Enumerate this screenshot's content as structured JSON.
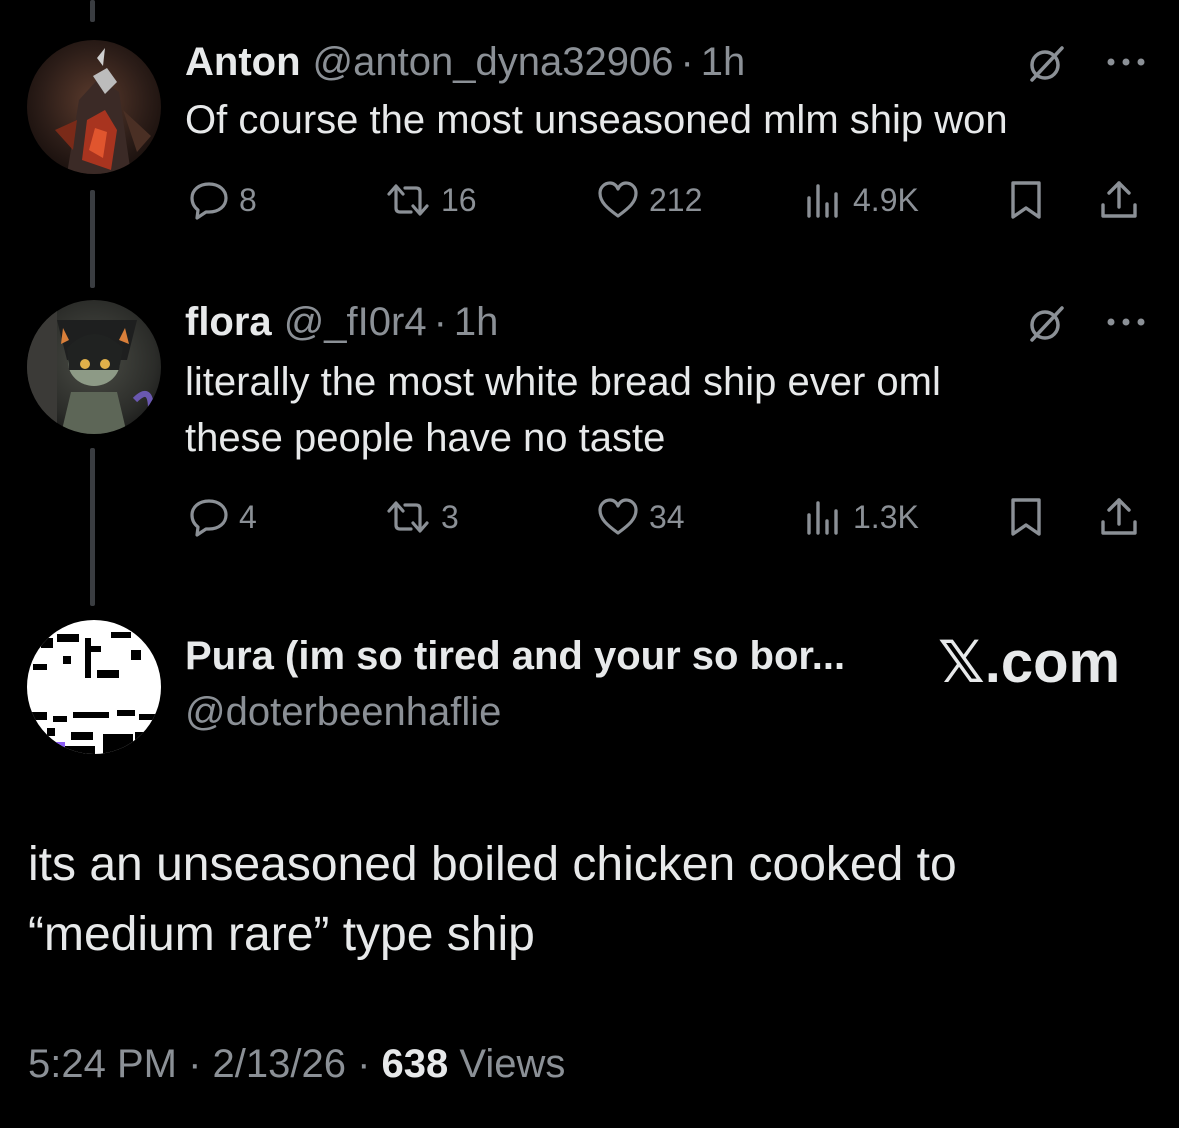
{
  "reply1": {
    "name": "Anton",
    "handle": "@anton_dyna32906",
    "separator": "·",
    "time": "1h",
    "text": "Of course the most unseasoned mlm ship won",
    "replies": "8",
    "reposts": "16",
    "likes": "212",
    "views": "4.9K"
  },
  "reply2": {
    "name": "flora",
    "handle": "@_fI0r4",
    "separator": "·",
    "time": "1h",
    "text_line1": "literally the most white bread ship ever oml",
    "text_line2": "these people have no taste",
    "replies": "4",
    "reposts": "3",
    "likes": "34",
    "views": "1.3K"
  },
  "main_post": {
    "name": "Pura (im so tired and your so bor...",
    "handle": "@doterbeenhaflie",
    "brand_letter": "𝕏",
    "brand_suffix": ".com",
    "text_line1": "its an unseasoned boiled chicken cooked to",
    "text_line2": "“medium rare” type ship",
    "timestamp": "5:24 PM · 2/13/26 · ",
    "views_count": "638",
    "views_label": " Views"
  },
  "icons": {
    "reply": "reply-icon",
    "repost": "repost-icon",
    "like": "heart-icon",
    "views": "analytics-icon",
    "bookmark": "bookmark-icon",
    "share": "share-icon",
    "grok": "grok-icon",
    "more": "more-icon"
  },
  "colors": {
    "background": "#000000",
    "text": "#e7e9ea",
    "secondary": "#8b9096",
    "thread_line": "#3a3d41"
  }
}
